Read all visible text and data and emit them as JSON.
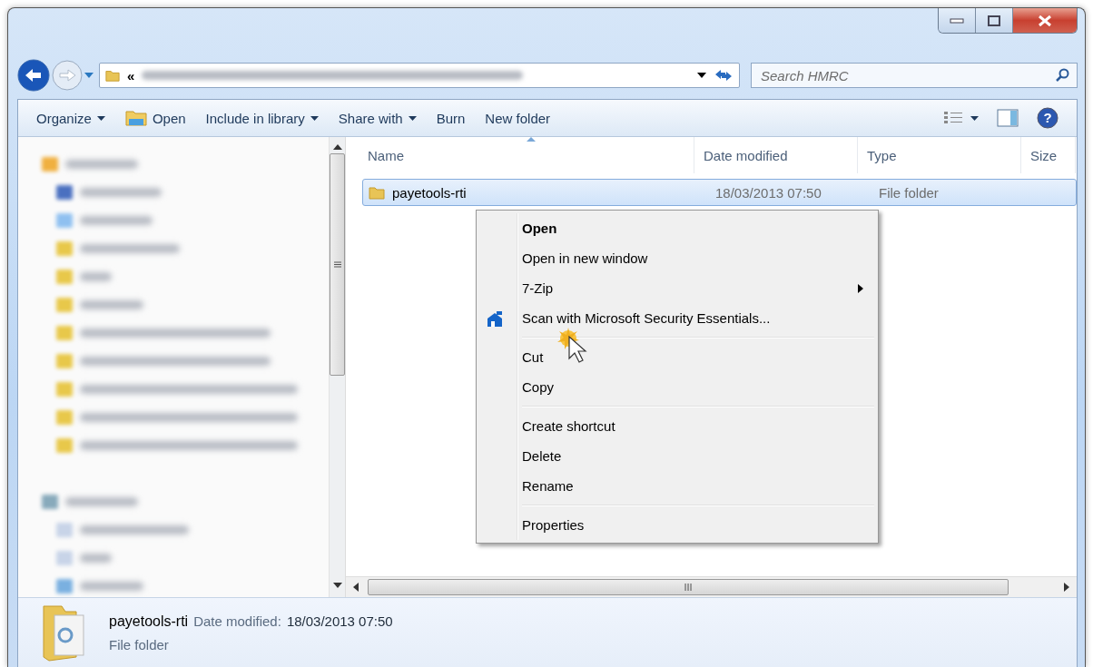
{
  "address_bar": {
    "overflow": "«"
  },
  "search": {
    "placeholder": "Search HMRC"
  },
  "toolbar": [
    {
      "label": "Organize",
      "kind": "dropdown"
    },
    {
      "label": "Open",
      "kind": "icon"
    },
    {
      "label": "Include in library",
      "kind": "dropdown"
    },
    {
      "label": "Share with",
      "kind": "dropdown"
    },
    {
      "label": "Burn",
      "kind": "plain"
    },
    {
      "label": "New folder",
      "kind": "plain"
    }
  ],
  "help_button": {
    "glyph": "?"
  },
  "columns": [
    {
      "label": "Name",
      "sorted": true
    },
    {
      "label": "Date modified",
      "sorted": false
    },
    {
      "label": "Type",
      "sorted": false
    },
    {
      "label": "Size",
      "sorted": false
    }
  ],
  "rows": [
    {
      "name": "payetools-rti",
      "date_modified": "18/03/2013 07:50",
      "type": "File folder",
      "selected": true
    }
  ],
  "context_menu": [
    {
      "kind": "default",
      "label": "Open"
    },
    {
      "kind": "item",
      "label": "Open in new window"
    },
    {
      "kind": "submenu",
      "label": "7-Zip"
    },
    {
      "kind": "icon",
      "label": "Scan with Microsoft Security Essentials..."
    },
    {
      "kind": "separator"
    },
    {
      "kind": "item",
      "label": "Cut"
    },
    {
      "kind": "item",
      "label": "Copy"
    },
    {
      "kind": "separator"
    },
    {
      "kind": "item",
      "label": "Create shortcut"
    },
    {
      "kind": "item",
      "label": "Delete"
    },
    {
      "kind": "item",
      "label": "Rename"
    },
    {
      "kind": "separator"
    },
    {
      "kind": "item",
      "label": "Properties"
    }
  ],
  "horizontal_scrollbar": {
    "grip": "III"
  },
  "details": {
    "name": "payetools-rti",
    "date_label": "Date modified:",
    "date_value": "18/03/2013 07:50",
    "type": "File folder"
  }
}
